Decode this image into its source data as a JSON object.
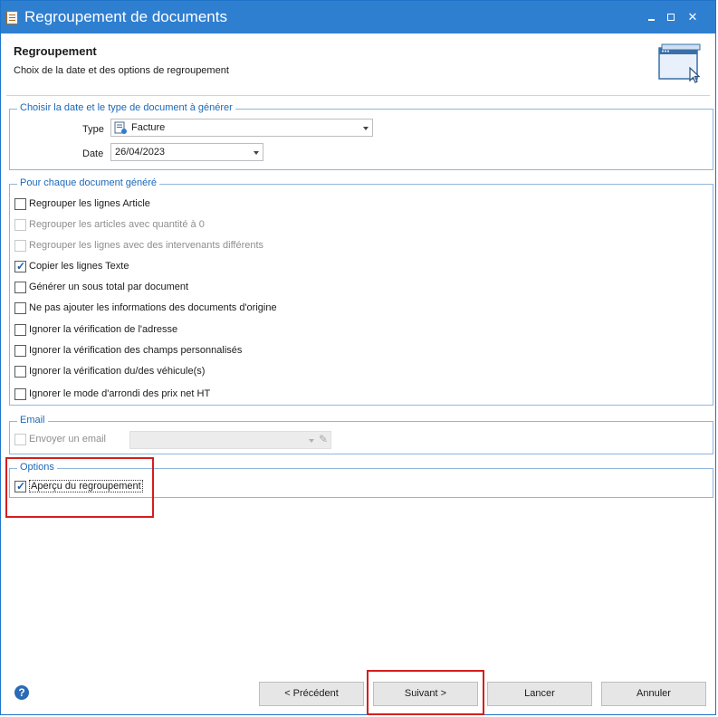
{
  "window": {
    "title": "Regroupement de documents"
  },
  "header": {
    "title": "Regroupement",
    "subtitle": "Choix de la date et des options de regroupement"
  },
  "group_date": {
    "legend": "Choisir la date et le type de document à générer",
    "type_label": "Type",
    "type_value": "Facture",
    "date_label": "Date",
    "date_value": "26/04/2023"
  },
  "group_each": {
    "legend": "Pour chaque document généré",
    "items": [
      {
        "label": "Regrouper les lignes Article",
        "checked": false,
        "disabled": false
      },
      {
        "label": "Regrouper les articles avec quantité à 0",
        "checked": false,
        "disabled": true
      },
      {
        "label": "Regrouper les lignes avec des intervenants différents",
        "checked": false,
        "disabled": true
      },
      {
        "label": "Copier les lignes Texte",
        "checked": true,
        "disabled": false
      },
      {
        "label": "Générer un sous total par document",
        "checked": false,
        "disabled": false
      },
      {
        "label": "Ne pas ajouter les informations des documents d'origine",
        "checked": false,
        "disabled": false
      },
      {
        "label": "Ignorer la vérification de l'adresse",
        "checked": false,
        "disabled": false
      },
      {
        "label": "Ignorer la vérification des champs personnalisés",
        "checked": false,
        "disabled": false
      },
      {
        "label": "Ignorer la vérification du/des véhicule(s)",
        "checked": false,
        "disabled": false
      },
      {
        "label": "Ignorer le mode d'arrondi des prix net HT",
        "checked": false,
        "disabled": false
      }
    ]
  },
  "group_email": {
    "legend": "Email",
    "send_label": "Envoyer un email",
    "checked": false,
    "disabled": true
  },
  "group_options": {
    "legend": "Options",
    "preview_label": "Aperçu du regroupement",
    "checked": true
  },
  "buttons": {
    "previous": "< Précédent",
    "next": "Suivant >",
    "launch": "Lancer",
    "cancel": "Annuler"
  },
  "colors": {
    "titlebar": "#2f7fd1",
    "group_border": "#8fb6dc",
    "legend_text": "#1c68b8",
    "highlight": "#d61d1d"
  }
}
